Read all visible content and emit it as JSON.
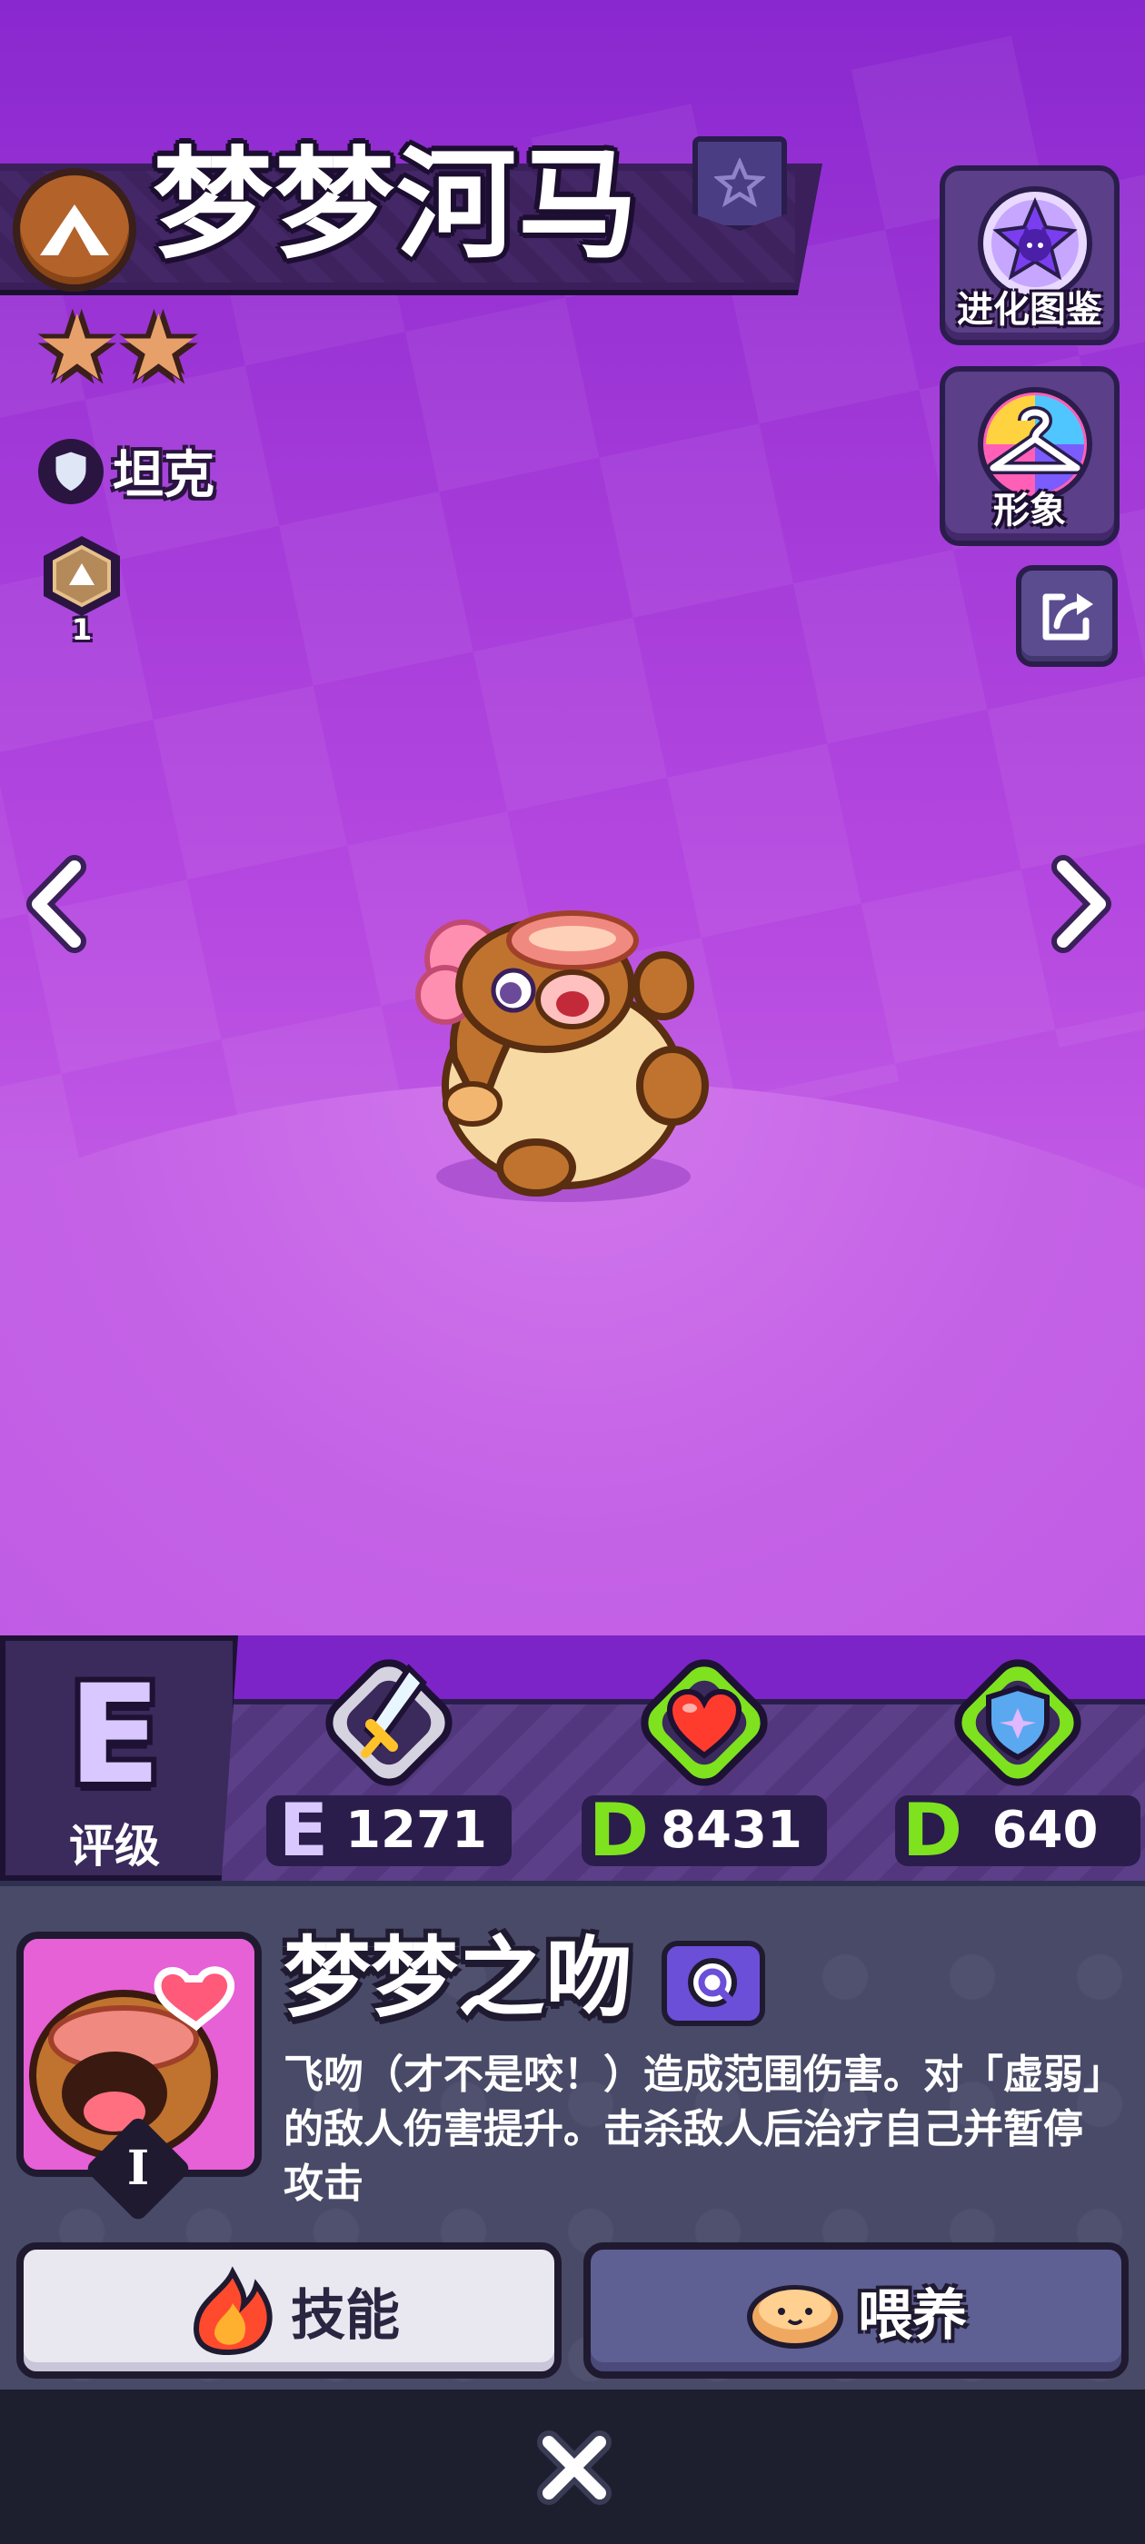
{
  "pet": {
    "name": "梦梦河马",
    "stars": 2,
    "role": "坦克",
    "level": "1"
  },
  "side_buttons": {
    "evolution_label": "进化图鉴",
    "skin_label": "形象"
  },
  "stats": {
    "grade_letter": "E",
    "grade_label": "评级",
    "attack": {
      "grade": "E",
      "value": "1271"
    },
    "hp": {
      "grade": "D",
      "value": "8431"
    },
    "defense": {
      "grade": "D",
      "value": "640"
    }
  },
  "skill": {
    "name": "梦梦之吻",
    "tier": "I",
    "description": "飞吻（才不是咬！）造成范围伤害。对「虚弱」的敌人伤害提升。击杀敌人后治疗自己并暂停攻击"
  },
  "actions": {
    "skill_label": "技能",
    "feed_label": "喂养"
  },
  "colors": {
    "grade_e": "#d9c8ff",
    "grade_d": "#7ee21f",
    "background_top": "#8a28cf",
    "background_bottom": "#c865e8"
  },
  "icons": {
    "rarity": "mountain-icon",
    "favorite": "star-icon",
    "role": "shield-icon",
    "evolution": "cat-star-icon",
    "skin": "hanger-icon",
    "share": "share-icon",
    "attack": "sword-icon",
    "hp": "heart-icon",
    "defense": "shield-icon",
    "search": "magnifier-icon",
    "skill": "flame-icon",
    "feed": "bread-icon",
    "close": "close-icon"
  }
}
